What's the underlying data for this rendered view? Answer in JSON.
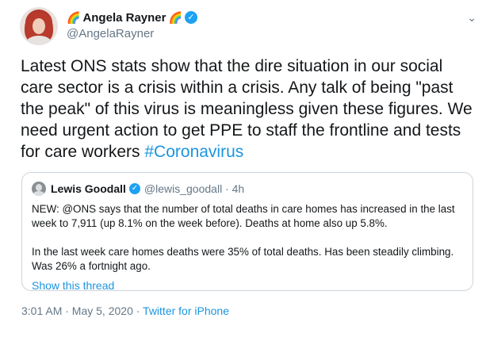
{
  "author": {
    "display_name": "Angela Rayner",
    "handle": "@AngelaRayner",
    "emoji_left": "🌈",
    "emoji_right": "🌈",
    "verified_glyph": "✓"
  },
  "menu_caret": "⌄",
  "tweet": {
    "text": "Latest ONS stats show that the dire situation in our social care sector is a crisis within a crisis. Any talk of being \"past the peak\" of this virus is meaningless given these figures. We need urgent action to get PPE to staff the frontline and tests for care workers ",
    "hashtag": "#Coronavirus"
  },
  "quote": {
    "display_name": "Lewis Goodall",
    "handle_time": "@lewis_goodall · 4h",
    "verified_glyph": "✓",
    "paragraph1": "NEW: @ONS says that the number of total deaths in care homes has increased in the last week to 7,911 (up 8.1% on the week before). Deaths at home also up 5.8%.",
    "paragraph2": "In the last week care homes deaths were 35% of total deaths. Has been steadily climbing. Was 26% a fortnight ago.",
    "show_thread": "Show this thread"
  },
  "meta": {
    "timestamp": "3:01 AM · May 5, 2020 · ",
    "source": "Twitter for iPhone"
  },
  "colors": {
    "link": "#1b95e0",
    "verified": "#1da1f2",
    "secondary_text": "#657786",
    "border": "#ccd6dd"
  }
}
